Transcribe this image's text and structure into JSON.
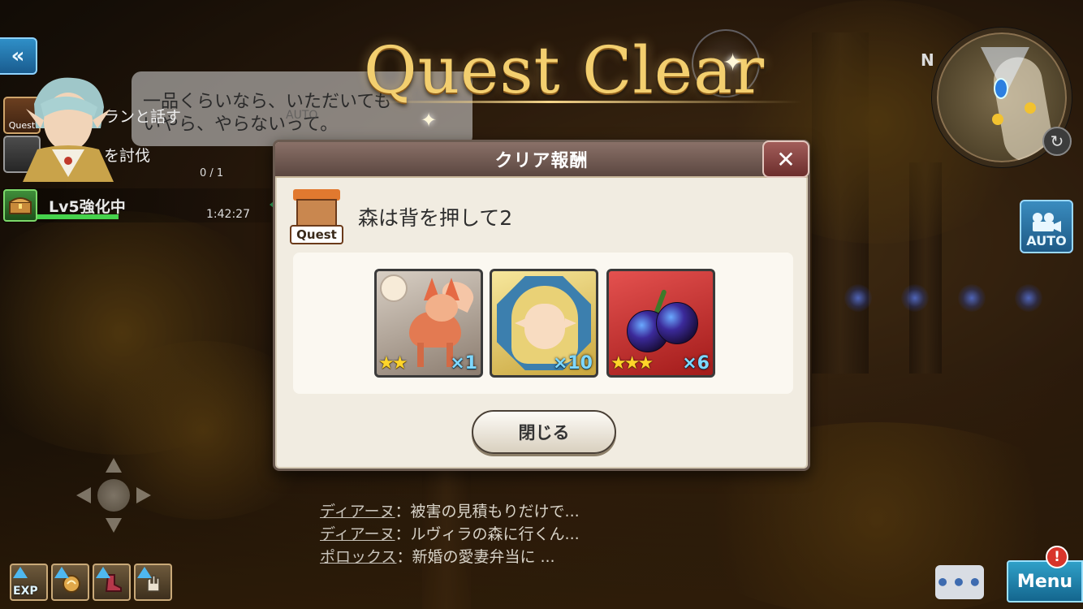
{
  "title": {
    "text": "Quest Clear"
  },
  "nav": {
    "back_icon": "«"
  },
  "speech_bubble": {
    "line1": "一品くらいなら、いただいても",
    "line2": "いやら、やらないって。",
    "auto_tag": "AUTO"
  },
  "quest_tracker": {
    "quest_label": "Quest",
    "item1": "ランと話す",
    "item2": "を討伐",
    "count": "0 / 1"
  },
  "enhance_status": {
    "label": "Lv5強化中",
    "timer": "1:42:27"
  },
  "minimap": {
    "north": "N",
    "rotate_icon": "↻"
  },
  "auto_camera": {
    "label": "AUTO"
  },
  "reward_dialog": {
    "header": "クリア報酬",
    "close_icon": "✕",
    "quest_badge": "Quest",
    "quest_name": "森は背を押して2",
    "rewards": [
      {
        "name": "winged-fox-companion",
        "stars": "★★",
        "qty": "×1"
      },
      {
        "name": "elf-girl-portrait",
        "stars": "",
        "qty": "×10"
      },
      {
        "name": "star-plum-fruit",
        "stars": "★★★",
        "qty": "×6"
      }
    ],
    "close_button": "閉じる"
  },
  "chat_log": [
    {
      "speaker": "ディアーヌ",
      "text": "：被害の見積もりだけで..."
    },
    {
      "speaker": "ディアーヌ",
      "text": "：ルヴィラの森に行くん..."
    },
    {
      "speaker": "ポロックス",
      "text": "：新婚の愛妻弁当に ..."
    }
  ],
  "bottom_left": {
    "exp_label": "EXP"
  },
  "bottom_right": {
    "chat_icon": "•••",
    "menu_label": "Menu",
    "alert": "!"
  },
  "colors": {
    "title_gold": "#f3cf6f",
    "dialog_bg": "#f1ece1",
    "dialog_header": "#6e5650",
    "qty_cyan": "#7fd8ff",
    "star_yellow": "#ffd52a"
  }
}
